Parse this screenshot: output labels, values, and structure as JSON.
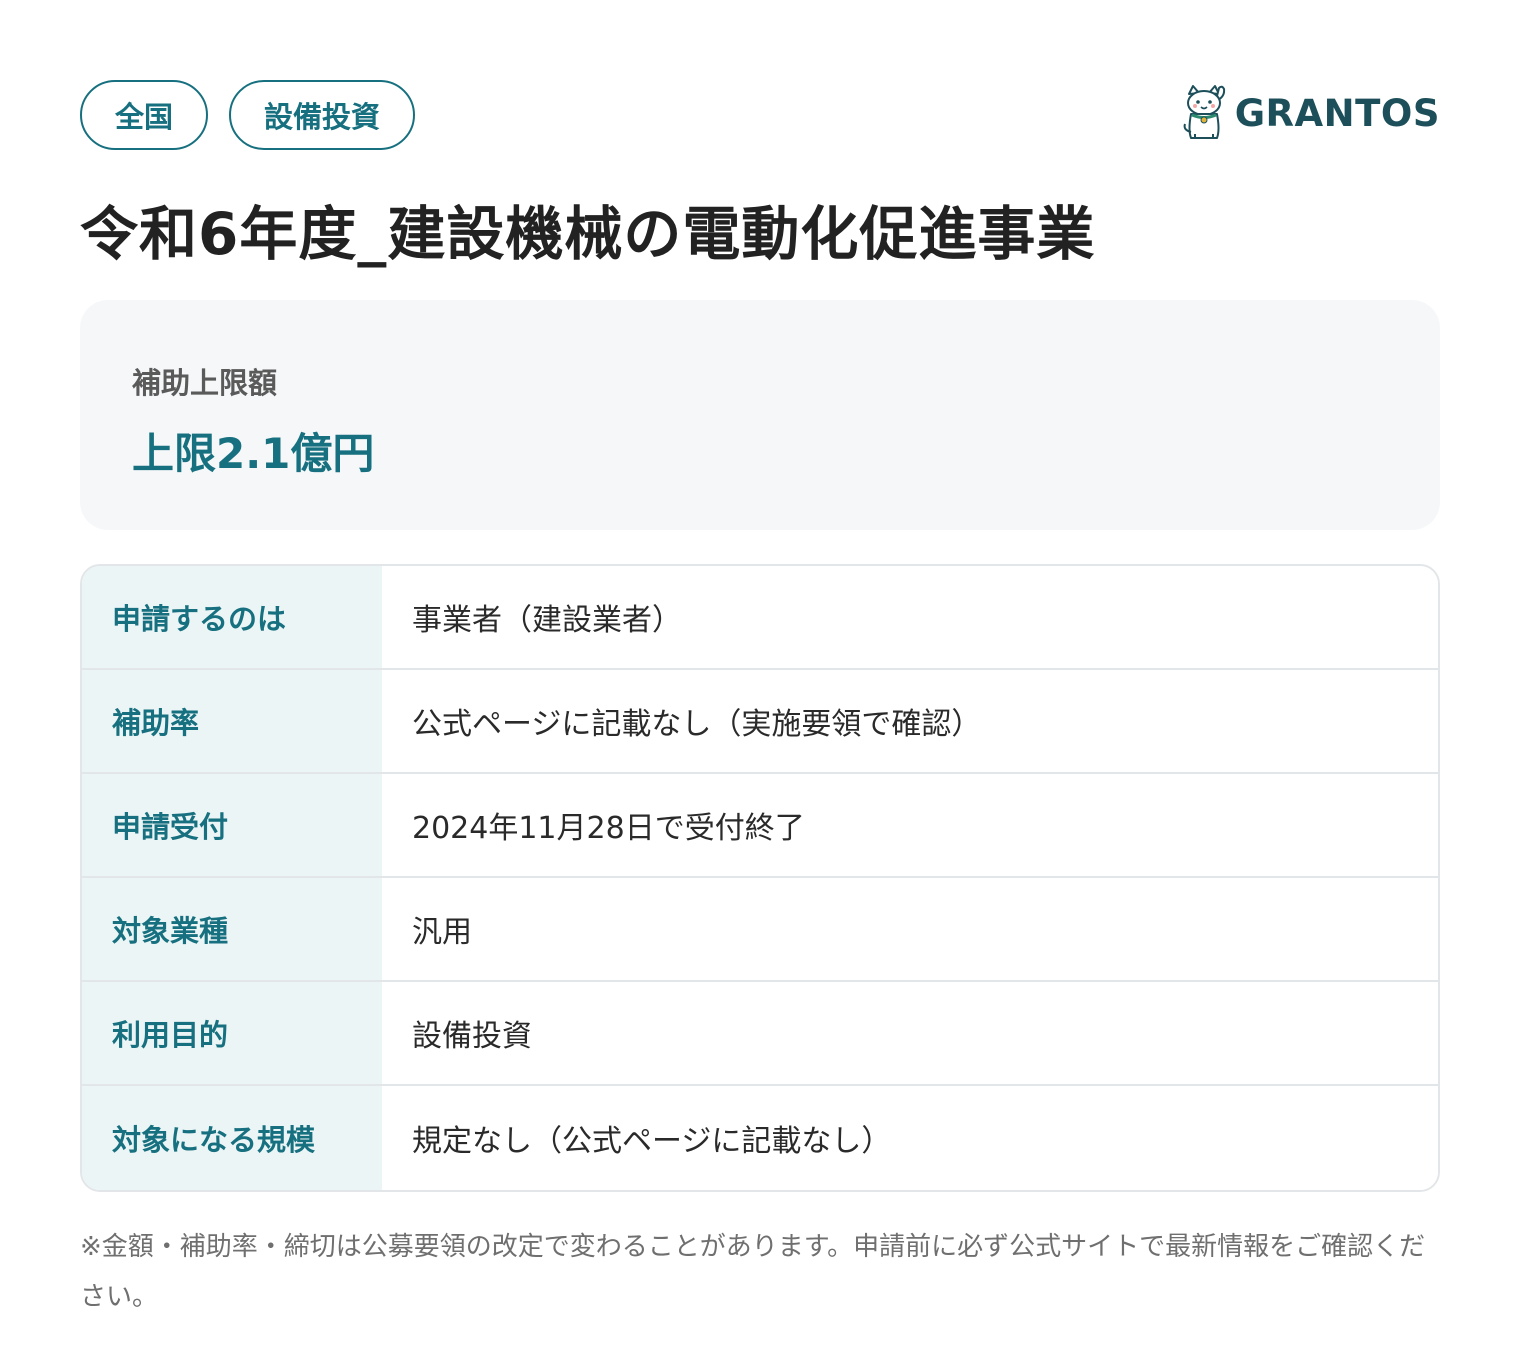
{
  "tags": [
    "全国",
    "設備投資"
  ],
  "logo": {
    "text": "GRANTOS",
    "icon": "maneki-neko-cat-icon"
  },
  "title": "令和6年度_建設機械の電動化促進事業",
  "amount": {
    "label": "補助上限額",
    "value": "上限2.1億円"
  },
  "info_rows": [
    {
      "key": "申請するのは",
      "value": "事業者（建設業者）"
    },
    {
      "key": "補助率",
      "value": "公式ページに記載なし（実施要領で確認）"
    },
    {
      "key": "申請受付",
      "value": "2024年11月28日で受付終了"
    },
    {
      "key": "対象業種",
      "value": "汎用"
    },
    {
      "key": "利用目的",
      "value": "設備投資"
    },
    {
      "key": "対象になる規模",
      "value": "規定なし（公式ページに記載なし）"
    }
  ],
  "footnote": "※金額・補助率・締切は公募要領の改定で変わることがあります。申請前に必ず公式サイトで最新情報をご確認ください。",
  "colors": {
    "accent": "#17707f",
    "logo_text": "#1d4f5a",
    "card_bg": "#f5f7f9",
    "key_bg": "#ebf5f6",
    "border": "#e3e6e8"
  }
}
